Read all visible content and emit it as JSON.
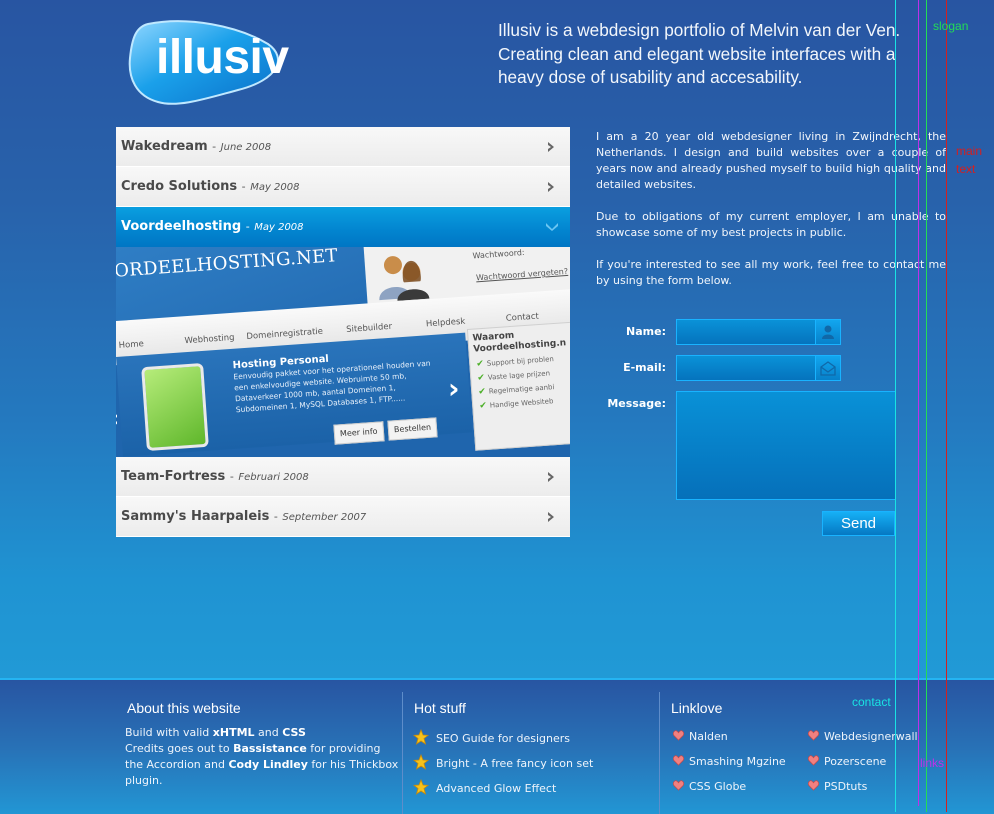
{
  "logo": {
    "text": "illusiv"
  },
  "slogan": "Illusiv is a webdesign portfolio of Melvin van der Ven. Creating clean and elegant website interfaces with a heavy dose of usability and accesability.",
  "portfolio": {
    "items": [
      {
        "title": "Wakedream",
        "date": "June 2008",
        "state": "collapsed"
      },
      {
        "title": "Credo Solutions",
        "date": "May 2008",
        "state": "collapsed"
      },
      {
        "title": "Voordeelhosting",
        "date": "May 2008",
        "state": "expanded"
      },
      {
        "title": "Team-Fortress",
        "date": "Februari 2008",
        "state": "collapsed"
      },
      {
        "title": "Sammy's Haarpaleis",
        "date": "September 2007",
        "state": "collapsed"
      }
    ],
    "separator": "-",
    "preview": {
      "brand": "ORDEELHOSTING.NET",
      "login_label": "Wachtwoord:",
      "forgot_link": "Wachtwoord vergeten?",
      "nav": [
        "Home",
        "Webhosting",
        "Domeinregistratie",
        "Sitebuilder",
        "Helpdesk",
        "Contact"
      ],
      "promo_title": "Hosting Personal",
      "promo_text": "Eenvoudig pakket voor  het operationeel houden van een enkelvoudige website. Webruimte 50 mb, Dataverkeer 1000 mb, aantal Domeinen 1, Subdomeinen 1, MySQL Databases 1, FTP......",
      "more_info": "Meer info",
      "order": "Bestellen",
      "side_title": "Waarom Voordeelhosting.n",
      "side_checks": [
        "Support bij problen",
        "Vaste lage prijzen",
        "Regelmatige aanbi",
        "Handige Websiteb"
      ]
    }
  },
  "intro": {
    "paragraphs": [
      "I am a 20 year old webdesigner living in Zwijndrecht, the Netherlands. I design and build websites over a couple of years now and already pushed myself to build high quality and detailed websites.",
      "Due to obligations of my current employer, I am unable to showcase some of my best projects in public.",
      "If you're interested to see all my work, feel free to contact me by using the form below."
    ]
  },
  "contact_form": {
    "name_label": "Name:",
    "name_value": "",
    "email_label": "E-mail:",
    "email_value": "",
    "message_label": "Message:",
    "message_value": "",
    "send_label": "Send",
    "name_icon": "user-icon",
    "email_icon": "envelope-icon"
  },
  "guides": {
    "slogan": "slogan",
    "main_text_1": "main",
    "main_text_2": "text",
    "contact": "contact",
    "links": "links",
    "colors": {
      "cyan": "#19e3e3",
      "magenta": "#c030e8",
      "green": "#22dd55",
      "red": "#d42020"
    }
  },
  "footer": {
    "about": {
      "heading": "About this website",
      "line1_prefix": "Build with valid ",
      "line1_b1": "xHTML",
      "line1_mid": " and ",
      "line1_b2": "CSS",
      "line2_prefix": "Credits goes out to ",
      "line2_b1": "Bassistance",
      "line2_mid": " for providing the Accordion and ",
      "line2_b2": "Cody Lindley",
      "line2_suffix": " for his Thickbox plugin."
    },
    "hot": {
      "heading": "Hot stuff",
      "items": [
        "SEO Guide for designers",
        "Bright - A free fancy icon set",
        "Advanced Glow Effect"
      ]
    },
    "linklove": {
      "heading": "Linklove",
      "col1": [
        "Nalden",
        "Smashing Mgzine",
        "CSS Globe"
      ],
      "col2": [
        "Webdesignerwall",
        "Pozerscene",
        "PSDtuts"
      ]
    }
  },
  "colors": {
    "accent": "#0284cf",
    "field_border": "#19b3ff",
    "footer_border": "#25b4f2"
  }
}
